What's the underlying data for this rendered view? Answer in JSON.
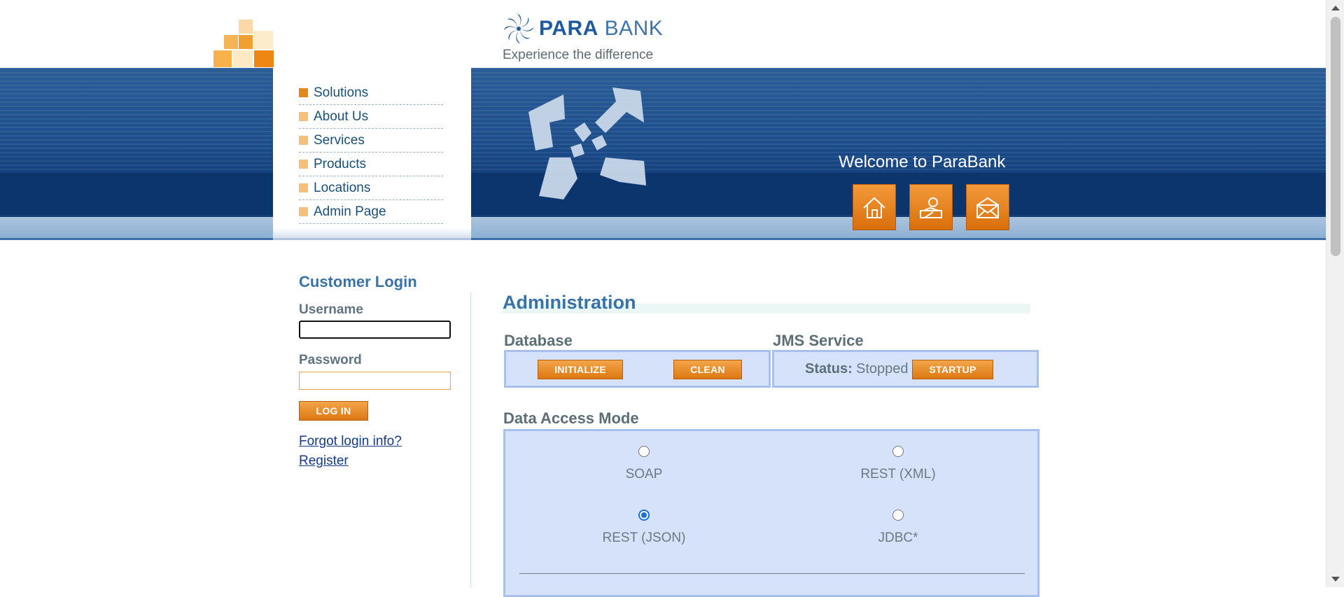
{
  "header": {
    "brand_bold": "PARA",
    "brand_light": "BANK",
    "slogan": "Experience the difference"
  },
  "menu": {
    "items": [
      {
        "label": "Solutions"
      },
      {
        "label": "About Us"
      },
      {
        "label": "Services"
      },
      {
        "label": "Products"
      },
      {
        "label": "Locations"
      },
      {
        "label": "Admin Page"
      }
    ]
  },
  "banner": {
    "welcome": "Welcome to ParaBank",
    "icons": [
      "home-icon",
      "contact-icon",
      "email-icon"
    ]
  },
  "login": {
    "title": "Customer Login",
    "username_label": "Username",
    "username_value": "",
    "password_label": "Password",
    "password_value": "",
    "login_button": "LOG IN",
    "forgot_link": "Forgot login info?",
    "register_link": "Register"
  },
  "admin": {
    "title": "Administration",
    "database": {
      "title": "Database",
      "initialize": "INITIALIZE",
      "clean": "CLEAN"
    },
    "jms": {
      "title": "JMS Service",
      "status_label": "Status:",
      "status_value": "Stopped",
      "startup": "STARTUP"
    },
    "data_access": {
      "title": "Data Access Mode",
      "options": [
        {
          "label": "SOAP",
          "checked": false
        },
        {
          "label": "REST (XML)",
          "checked": false
        },
        {
          "label": "REST (JSON)",
          "checked": true
        },
        {
          "label": "JDBC*",
          "checked": false
        }
      ]
    }
  },
  "colors": {
    "accent_orange": "#e08a1a",
    "brand_blue": "#3873a8",
    "banner_blue": "#1e4f8c",
    "panel_fill": "#d5e2fa"
  }
}
